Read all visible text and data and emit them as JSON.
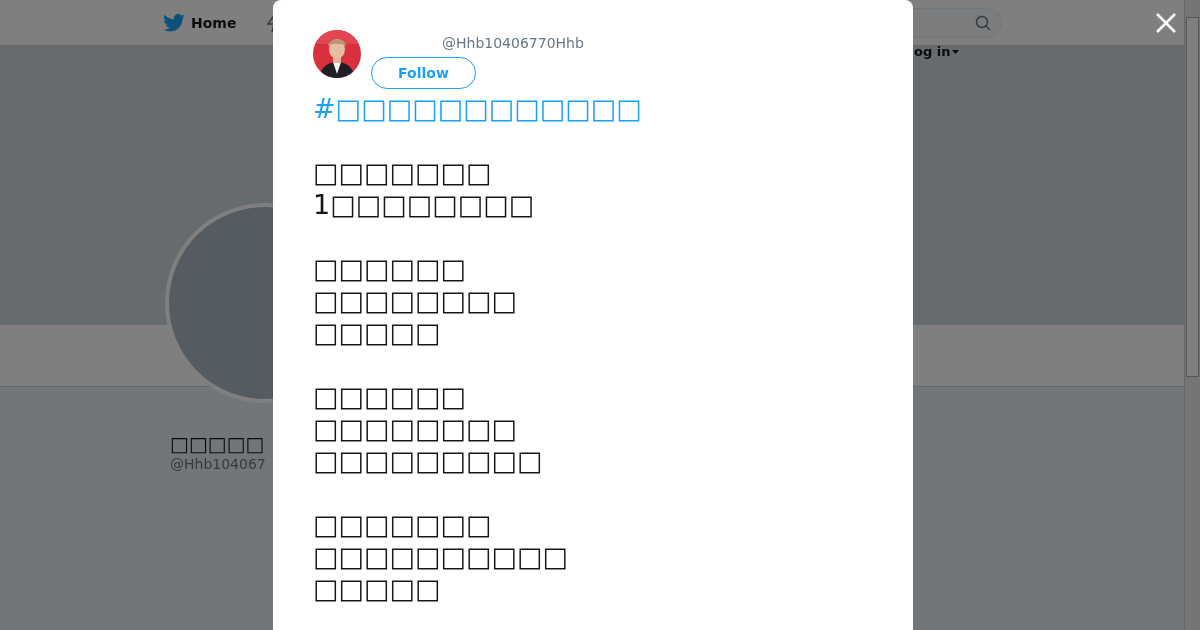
{
  "nav": {
    "home": "Home",
    "login": "og in"
  },
  "profile": {
    "name": "□□□□□",
    "handle": "@Hhb104067"
  },
  "tweet": {
    "handle": "@Hhb10406770Hhb",
    "follow": "Follow",
    "hashtag": "#□□□□□□□□□□□□",
    "paragraphs": [
      [
        "□□□□□□□",
        "1□□□□□□□□"
      ],
      [
        "□□□□□□",
        "□□□□□□□□",
        "□□□□□"
      ],
      [
        "□□□□□□",
        "□□□□□□□□",
        "□□□□□□□□□"
      ],
      [
        "□□□□□□□",
        "□□□□□□□□□□",
        "□□□□□"
      ]
    ]
  }
}
